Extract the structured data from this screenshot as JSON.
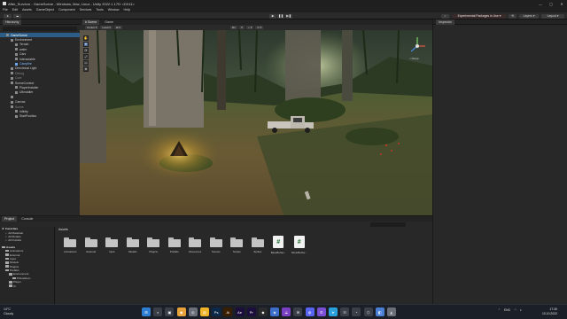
{
  "window": {
    "title": "After_Survivor - GameScene - Windows, Mac, Linux - Unity 2022.1.17f1 <DX11>",
    "controls": [
      "—",
      "▢",
      "✕"
    ]
  },
  "menu": [
    "File",
    "Edit",
    "Assets",
    "GameObject",
    "Component",
    "Services",
    "Tools",
    "Window",
    "Help"
  ],
  "toolbar": {
    "play": "▶",
    "pause": "❚❚",
    "step": "▶❚",
    "experimental_packages": "Experimental Packages in Use ▾",
    "layers": "Layers ▾",
    "layout": "Layout ▾"
  },
  "hierarchy": {
    "tab": "Hierarchy",
    "rows": [
      {
        "label": "GameScene",
        "indent": 1,
        "style": "sel"
      },
      {
        "label": "Environment",
        "indent": 2,
        "style": ""
      },
      {
        "label": "Terrain",
        "indent": 3,
        "style": ""
      },
      {
        "label": "water",
        "indent": 3,
        "style": ""
      },
      {
        "label": "Cars",
        "indent": 3,
        "style": ""
      },
      {
        "label": "Interactable",
        "indent": 3,
        "style": ""
      },
      {
        "label": "Campfire",
        "indent": 3,
        "style": "blue"
      },
      {
        "label": "Directional Light",
        "indent": 2,
        "style": ""
      },
      {
        "label": "Debug",
        "indent": 2,
        "style": "dim"
      },
      {
        "label": "Core",
        "indent": 2,
        "style": "dim"
      },
      {
        "label": "SceneContext",
        "indent": 2,
        "style": ""
      },
      {
        "label": "PlayerInstaller",
        "indent": 3,
        "style": ""
      },
      {
        "label": "UIInstaller",
        "indent": 3,
        "style": ""
      },
      {
        "label": "",
        "indent": 2,
        "style": ""
      },
      {
        "label": "Canvas",
        "indent": 2,
        "style": ""
      },
      {
        "label": "Scene",
        "indent": 2,
        "style": "dim"
      },
      {
        "label": "Infinity",
        "indent": 3,
        "style": ""
      },
      {
        "label": "StartPosition",
        "indent": 3,
        "style": ""
      }
    ]
  },
  "scene": {
    "tabs": [
      "# Scene",
      "Game"
    ],
    "tools": [
      "Center ▾",
      "Local ▾",
      "⊞ ▾",
      "2D",
      "☀",
      "◐ ▾",
      "⊙ ▾"
    ],
    "palette": [
      "✋",
      "✥",
      "⟳",
      "⤢",
      "▭",
      "⊕"
    ],
    "persp_label": "< Persp"
  },
  "inspector": {
    "tab": "Inspector"
  },
  "project": {
    "tabs": [
      "Project",
      "Console"
    ],
    "favorites": "Favorites",
    "fav_items": [
      "All Materials",
      "All Models",
      "All Prefabs"
    ],
    "assets_label": "Assets",
    "tree": [
      {
        "label": "Assets",
        "indent": 0,
        "bold": true
      },
      {
        "label": "Animations",
        "indent": 1,
        "bold": false
      },
      {
        "label": "External",
        "indent": 1,
        "bold": false
      },
      {
        "label": "Input",
        "indent": 1,
        "bold": false
      },
      {
        "label": "Models",
        "indent": 1,
        "bold": false
      },
      {
        "label": "Plugins",
        "indent": 1,
        "bold": false
      },
      {
        "label": "Prefabs",
        "indent": 1,
        "bold": false
      },
      {
        "label": "Environment",
        "indent": 2,
        "bold": false
      },
      {
        "label": "PickupItem",
        "indent": 3,
        "bold": false
      },
      {
        "label": "Player",
        "indent": 2,
        "bold": false
      },
      {
        "label": "UI",
        "indent": 2,
        "bold": false
      }
    ],
    "path": "Assets",
    "items": [
      {
        "label": "Animations",
        "kind": "folder"
      },
      {
        "label": "External",
        "kind": "folder"
      },
      {
        "label": "Input",
        "kind": "folder"
      },
      {
        "label": "Models",
        "kind": "folder"
      },
      {
        "label": "Plugins",
        "kind": "folder"
      },
      {
        "label": "Prefabs",
        "kind": "folder"
      },
      {
        "label": "Resources",
        "kind": "folder"
      },
      {
        "label": "Scenes",
        "kind": "folder"
      },
      {
        "label": "Scripts",
        "kind": "folder"
      },
      {
        "label": "Sprites",
        "kind": "folder"
      },
      {
        "label": "BaseBehav...",
        "kind": "script"
      },
      {
        "label": "MonoBehav...",
        "kind": "script"
      }
    ]
  },
  "taskbar": {
    "temp": "14°C",
    "weather": "Cloudy",
    "lang": "ENG",
    "time": "17:30",
    "date": "10.10.2022",
    "apps": [
      {
        "glyph": "⊞",
        "color": "#2d7dd2",
        "name": "start"
      },
      {
        "glyph": "⌕",
        "color": "#3a3f4a",
        "name": "search"
      },
      {
        "glyph": "▣",
        "color": "#3a3f4a",
        "name": "taskview"
      },
      {
        "glyph": "◉",
        "color": "#e8a23a",
        "name": "chrome"
      },
      {
        "glyph": "◎",
        "color": "#6a6f7a",
        "name": "steam"
      },
      {
        "glyph": "▤",
        "color": "#f0b429",
        "name": "explorer"
      },
      {
        "glyph": "Ps",
        "color": "#0b2a4a",
        "name": "photoshop"
      },
      {
        "glyph": "Ai",
        "color": "#3a1e00",
        "name": "illustrator"
      },
      {
        "glyph": "Ae",
        "color": "#1c0f3d",
        "name": "after-effects"
      },
      {
        "glyph": "Pr",
        "color": "#1c0f3d",
        "name": "premiere"
      },
      {
        "glyph": "◆",
        "color": "#2b2b2b",
        "name": "unity-hub"
      },
      {
        "glyph": "◈",
        "color": "#3c6ec9",
        "name": "blender"
      },
      {
        "glyph": "⟁",
        "color": "#7a3fc2",
        "name": "visual-studio"
      },
      {
        "glyph": "✉",
        "color": "#3a3f4a",
        "name": "mail"
      },
      {
        "glyph": "◍",
        "color": "#5865f2",
        "name": "discord"
      },
      {
        "glyph": "✆",
        "color": "#7a4fd6",
        "name": "viber"
      },
      {
        "glyph": "➤",
        "color": "#2aa1da",
        "name": "telegram"
      },
      {
        "glyph": "☷",
        "color": "#3a3f4a",
        "name": "notes"
      },
      {
        "glyph": "◔",
        "color": "#3a3f4a",
        "name": "widgets"
      },
      {
        "glyph": "⬡",
        "color": "#3a3f4a",
        "name": "terminal"
      },
      {
        "glyph": "◧",
        "color": "#4a7fd6",
        "name": "game"
      },
      {
        "glyph": "◭",
        "color": "#6a6f7a",
        "name": "unity"
      }
    ]
  }
}
